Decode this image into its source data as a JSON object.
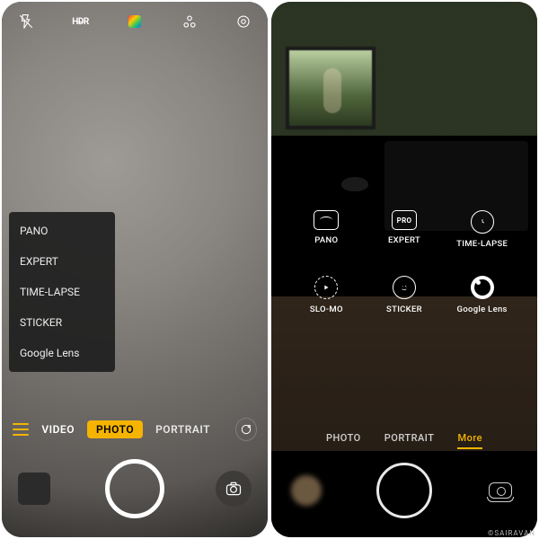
{
  "left": {
    "top_icons": [
      "flash-off",
      "hdr",
      "filter-color",
      "ai-scene",
      "settings-gear"
    ],
    "menu": {
      "items": [
        {
          "label": "PANO"
        },
        {
          "label": "EXPERT"
        },
        {
          "label": "TIME-LAPSE"
        },
        {
          "label": "STICKER"
        },
        {
          "label": "Google Lens"
        }
      ]
    },
    "modes": {
      "video": "VIDEO",
      "photo": "PHOTO",
      "portrait": "PORTRAIT"
    }
  },
  "right": {
    "grid": {
      "pano": {
        "label": "PANO"
      },
      "expert": {
        "label": "EXPERT",
        "badge": "PRO"
      },
      "timelapse": {
        "label": "TIME-LAPSE"
      },
      "slomo": {
        "label": "SLO-MO"
      },
      "sticker": {
        "label": "STICKER"
      },
      "googlelens": {
        "label": "Google Lens"
      }
    },
    "modes": {
      "photo": "PHOTO",
      "portrait": "PORTRAIT",
      "more": "More"
    }
  },
  "watermark": "©SAIRAVAN"
}
